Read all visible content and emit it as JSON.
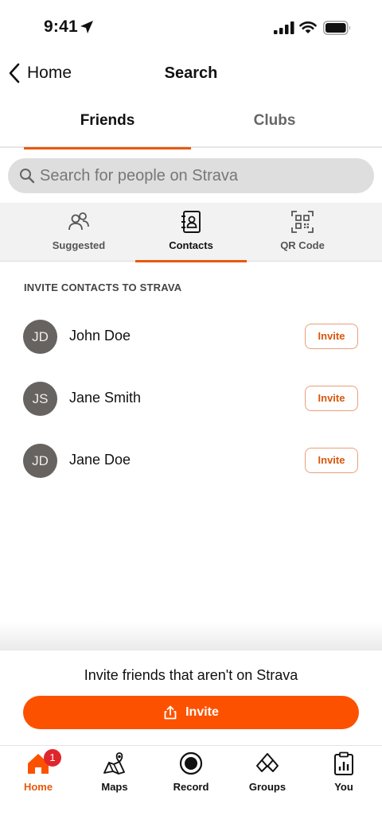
{
  "status_bar": {
    "time": "9:41"
  },
  "nav": {
    "back_label": "Home",
    "title": "Search"
  },
  "top_tabs": [
    {
      "label": "Friends",
      "active": true
    },
    {
      "label": "Clubs",
      "active": false
    }
  ],
  "search": {
    "placeholder": "Search for people on Strava"
  },
  "sub_tabs": [
    {
      "label": "Suggested",
      "icon": "people-icon",
      "active": false
    },
    {
      "label": "Contacts",
      "icon": "contact-book-icon",
      "active": true
    },
    {
      "label": "QR Code",
      "icon": "qr-code-icon",
      "active": false
    }
  ],
  "section": {
    "header": "INVITE CONTACTS TO STRAVA"
  },
  "contacts": [
    {
      "initials": "JD",
      "name": "John Doe",
      "action": "Invite"
    },
    {
      "initials": "JS",
      "name": "Jane Smith",
      "action": "Invite"
    },
    {
      "initials": "JD",
      "name": "Jane Doe",
      "action": "Invite"
    }
  ],
  "invite_panel": {
    "text": "Invite friends that aren't on Strava",
    "button_label": "Invite"
  },
  "bottom_nav": [
    {
      "label": "Home",
      "icon": "home-icon",
      "active": true,
      "badge": "1"
    },
    {
      "label": "Maps",
      "icon": "map-icon",
      "active": false
    },
    {
      "label": "Record",
      "icon": "record-icon",
      "active": false
    },
    {
      "label": "Groups",
      "icon": "groups-icon",
      "active": false
    },
    {
      "label": "You",
      "icon": "clipboard-chart-icon",
      "active": false
    }
  ],
  "colors": {
    "accent": "#fc5200",
    "tab_underline": "#e8590c",
    "avatar": "#666360",
    "badge": "#e0262d"
  }
}
